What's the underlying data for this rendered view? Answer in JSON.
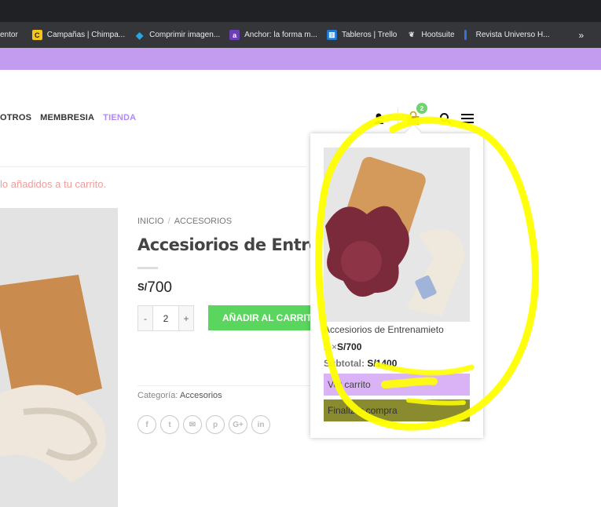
{
  "browser": {
    "bookmarks": [
      {
        "label": "entor",
        "icon": ""
      },
      {
        "label": "Campañas | Chimpa...",
        "icon": "chimp-icon",
        "color": "#f5c518"
      },
      {
        "label": "Comprimir imagen...",
        "icon": "compress-icon",
        "color": "#27a5e0"
      },
      {
        "label": "Anchor: la forma m...",
        "icon": "anchor-icon",
        "color": "#6b3fb5"
      },
      {
        "label": "Tableros | Trello",
        "icon": "trello-icon",
        "color": "#1f78d1"
      },
      {
        "label": "Hootsuite",
        "icon": "owl-icon",
        "color": "#dddddd"
      },
      {
        "label": "Revista Universo H...",
        "icon": "bookmark-icon",
        "color": "#3a6fd8"
      }
    ],
    "more": "»"
  },
  "nav": {
    "items": [
      "OTROS",
      "MEMBRESIA",
      "TIENDA"
    ],
    "active": "TIENDA"
  },
  "header": {
    "cart_count": "2"
  },
  "notice": "lo añadidos a tu carrito.",
  "product": {
    "breadcrumb": [
      "INICIO",
      "ACCESORIOS"
    ],
    "breadcrumb_sep": "/",
    "title": "Accesiorios de Entrena",
    "currency": "S/",
    "price": "700",
    "qty_minus": "-",
    "qty_value": "2",
    "qty_plus": "+",
    "add_to_cart": "AÑADIR AL CARRITO",
    "category_label": "Categoría:",
    "category_value": "Accesorios",
    "share": [
      "f",
      "t",
      "✉",
      "p",
      "G+",
      "in"
    ]
  },
  "cart_dropdown": {
    "item_name": "Accesiorios de Entrenamieto",
    "item_qty": "2 ×",
    "item_price": "S/700",
    "subtotal_label": "Subtotal:",
    "subtotal_value": "S/1400",
    "view_cart": "Ver carrito",
    "checkout": "Finalizar compra"
  },
  "colors": {
    "accent": "#c39cf0",
    "add_to_cart": "#5ad65f",
    "badge": "#6fd36f",
    "annotation": "#ffff00"
  }
}
